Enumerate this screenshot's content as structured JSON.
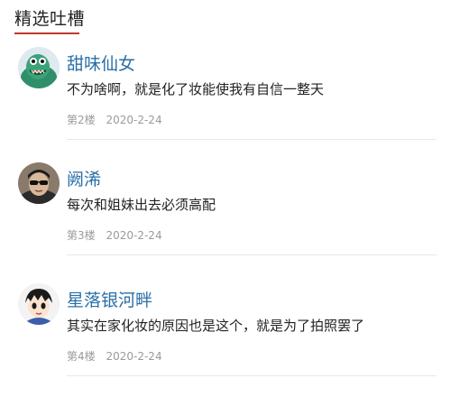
{
  "section_title": "精选吐槽",
  "comments": [
    {
      "username": "甜味仙女",
      "content": "不为啥啊，就是化了妆能使我有自信一整天",
      "floor": "第2楼",
      "date": "2020-2-24",
      "avatar_icon": "cartoon-dinosaur-avatar"
    },
    {
      "username": "阙浠",
      "content": "每次和姐妹出去必须高配",
      "floor": "第3楼",
      "date": "2020-2-24",
      "avatar_icon": "man-with-sunglasses-avatar"
    },
    {
      "username": "星落银河畔",
      "content": "其实在家化妆的原因也是这个，就是为了拍照罢了",
      "floor": "第4楼",
      "date": "2020-2-24",
      "avatar_icon": "anime-boy-avatar"
    }
  ],
  "colors": {
    "accent_underline": "#c0392b",
    "username": "#2a6fa8",
    "meta": "#9a9a9a"
  }
}
